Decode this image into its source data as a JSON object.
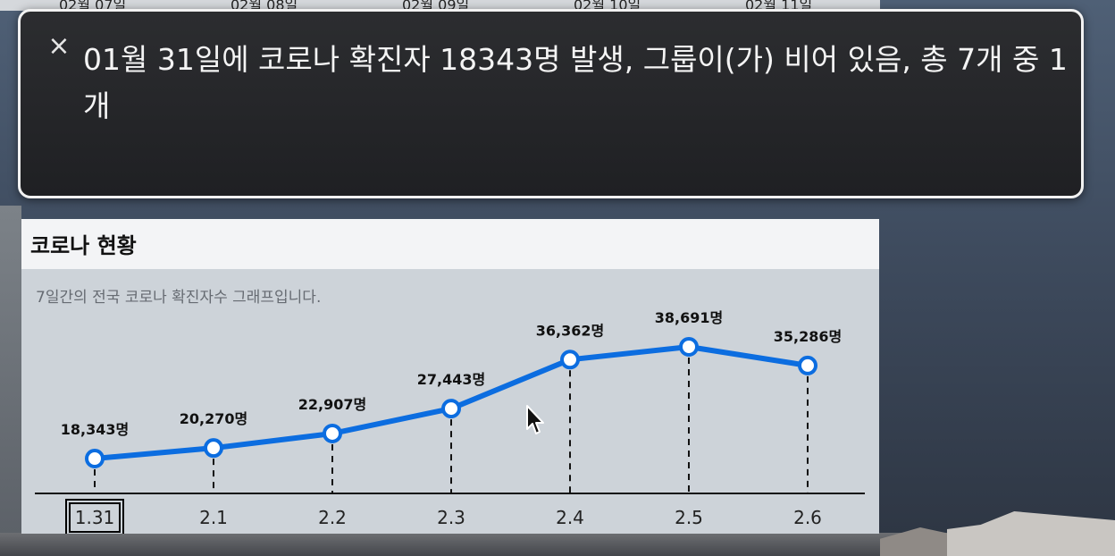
{
  "background": {
    "date_strip": [
      "02월 07일",
      "02월 08일",
      "02월 09일",
      "02월 10일",
      "02월 11일"
    ]
  },
  "caption": {
    "text": "01월 31일에 코로나 확진자 18343명 발생, 그룹이(가) 비어 있음, 총 7개 중 1개",
    "close_icon": "×"
  },
  "widget": {
    "title": "코로나 현황",
    "subtitle": "7일간의 전국 코로나 확진자수 그래프입니다."
  },
  "colors": {
    "line": "#0c6de0",
    "panel_bg": "#232427",
    "card_bg": "#cdd3d9"
  },
  "chart_data": {
    "type": "line",
    "categories": [
      "1.31",
      "2.1",
      "2.2",
      "2.3",
      "2.4",
      "2.5",
      "2.6"
    ],
    "series": [
      {
        "values": [
          18343,
          20270,
          22907,
          27443,
          36362,
          38691,
          35286
        ]
      }
    ],
    "data_labels": [
      "18,343명",
      "20,270명",
      "22,907명",
      "27,443명",
      "36,362명",
      "38,691명",
      "35,286명"
    ],
    "selected_index": 0,
    "grid": false
  }
}
